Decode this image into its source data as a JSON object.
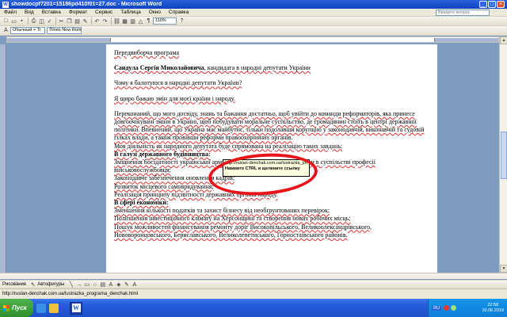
{
  "window": {
    "title": "showdocpf7201=15186pd410f01=27.doc - Microsoft Word",
    "app_icon": "W"
  },
  "menu": {
    "items": [
      "Файл",
      "Вид",
      "Вставка",
      "Формат",
      "Сервис",
      "Таблица",
      "Окно",
      "Справка"
    ],
    "help_placeholder": "Введите вопрос"
  },
  "toolbar": {
    "zoom": "110%",
    "style": "Обычный + Ti",
    "font": "Times New Roman"
  },
  "document": {
    "line1": "Передвиборча програма",
    "heading_name": "Сандула Сергія Миколайовича",
    "heading_rest": ", кандидата в народні депутати України",
    "question": "Чому я балотуюся в народні депутати України?",
    "love": "Я щиро бажаю змін для моєї країни і народу.",
    "para_conv": "Переконаний, що мого досвіду, знань та бажання достатньо, щоб увійти до команди реформаторів, яка принесе довгоочікувані зміни в Україні, щоб побудувати моральне суспільство, де громадянин стоїть в центрі державної політики. Впевнений, що Україна має майбутнє, тільки подолавши корупцію у законодавчій, виконавчій та судовій гілках влади, а також провівши реформи правоохоронних органів.",
    "mission": "Моя діяльність як народного депутата буде спрямована на реалізацію таких завдань:",
    "sec1_title": "В галузі державного будівництва:",
    "sec1_item1": "Зміцнення боєздатності української армії, повернення авторитету і поваги в суспільстві професії військовослужбовця;",
    "sec1_item2": "Законодавче забезпечення оновлення кадрів;",
    "sec1_item3": "Розвиток місцевого самоврядування;",
    "sec1_item4": "Реалізація принципу підзвітності державних органів народу.",
    "sec2_title": "В сфері економіки:",
    "sec2_item1": "Зменшення кількості податків та захист бізнесу від необґрунтованих перевірок;",
    "sec2_item2": "Поліпшення інвестиційного клімату на Херсонщині та створення нових робочих місць;",
    "sec2_item3": "Пошук можливостей фінансування ремонту доріг Високопільського, Великоолександрівського, Нововоронцовського, Бериславського, Великолепетиського, Горностаївського районів."
  },
  "tooltip": {
    "url": "http://ruslan-denchak.com.ua/lustrazka_programa_denchak.html",
    "hint": "Нажмите CTRL и щелкните ссылку"
  },
  "drawing_toolbar": {
    "draw_label": "Рисование",
    "autoshapes_label": "Автофигуры"
  },
  "status": {
    "text": "http://ruslan-denchak.com.ua/lustrazka_programa_denchak.html"
  },
  "taskbar": {
    "start_label": "Пуск",
    "lang": "RU",
    "time": "22:58",
    "date": "10.06.2019"
  },
  "colors": {
    "annotation_ellipse": "#e8141a",
    "title_bar": "#0b43c2",
    "tooltip_bg": "#ffffe1"
  }
}
